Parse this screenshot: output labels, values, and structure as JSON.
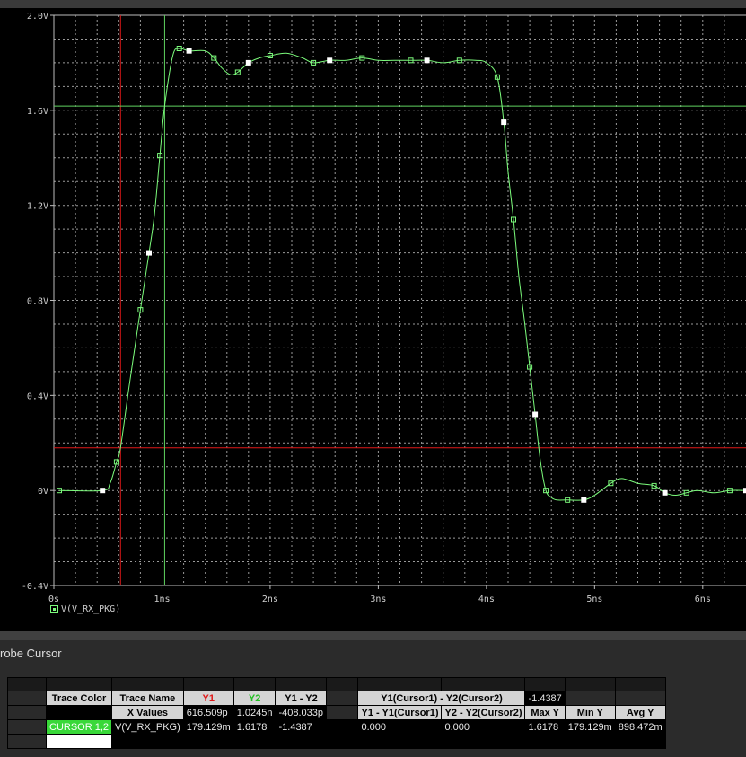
{
  "chart_data": {
    "type": "line",
    "x": [
      0.05,
      0.45,
      0.52,
      0.58,
      0.616,
      0.7,
      0.8,
      0.88,
      0.93,
      0.98,
      1.0245,
      1.1,
      1.16,
      1.25,
      1.4,
      1.48,
      1.55,
      1.63,
      1.7,
      1.8,
      1.9,
      2.0,
      2.15,
      2.3,
      2.4,
      2.55,
      2.7,
      2.85,
      3.0,
      3.15,
      3.3,
      3.45,
      3.6,
      3.75,
      3.9,
      4.0,
      4.1,
      4.16,
      4.2,
      4.25,
      4.3,
      4.35,
      4.4,
      4.45,
      4.5,
      4.55,
      4.6,
      4.65,
      4.75,
      4.9,
      5.0,
      5.15,
      5.25,
      5.4,
      5.55,
      5.65,
      5.75,
      5.85,
      5.95,
      6.1,
      6.25,
      6.4
    ],
    "values": [
      0.0,
      0.0,
      0.03,
      0.12,
      0.179,
      0.45,
      0.76,
      1.0,
      1.16,
      1.41,
      1.6178,
      1.83,
      1.86,
      1.85,
      1.85,
      1.82,
      1.78,
      1.75,
      1.76,
      1.8,
      1.82,
      1.83,
      1.84,
      1.82,
      1.8,
      1.81,
      1.81,
      1.82,
      1.81,
      1.81,
      1.81,
      1.81,
      1.8,
      1.81,
      1.81,
      1.8,
      1.74,
      1.55,
      1.34,
      1.14,
      0.9,
      0.72,
      0.52,
      0.32,
      0.12,
      0.0,
      -0.03,
      -0.04,
      -0.04,
      -0.04,
      -0.02,
      0.03,
      0.05,
      0.03,
      0.02,
      -0.01,
      -0.02,
      -0.01,
      0.0,
      -0.01,
      0.0,
      0.0
    ],
    "xlim": [
      0,
      6.4
    ],
    "ylim": [
      -0.4,
      2.0
    ],
    "x_ticks": [
      0,
      1,
      2,
      3,
      4,
      5,
      6
    ],
    "x_tick_labels": [
      "0s",
      "1ns",
      "2ns",
      "3ns",
      "4ns",
      "5ns",
      "6ns"
    ],
    "y_ticks": [
      -0.4,
      0,
      0.4,
      0.8,
      1.2,
      1.6,
      2.0
    ],
    "y_tick_labels": [
      "-0.4V",
      "0V",
      "0.4V",
      "0.8V",
      "1.2V",
      "1.6V",
      "2.0V"
    ],
    "series_name": "V(V_RX_PKG)",
    "grid": true,
    "cursor1": {
      "x": 0.616509,
      "y": 0.179129,
      "color": "#e01818"
    },
    "cursor2": {
      "x": 1.0245,
      "y": 1.6178,
      "color": "#5fd35f"
    },
    "trace_color": "#7CFC7C"
  },
  "panel": {
    "title": "robe Cursor"
  },
  "table": {
    "h_trace_color": "Trace Color",
    "h_trace_name": "Trace Name",
    "h_y1": "Y1",
    "h_y2": "Y2",
    "h_y1_y2": "Y1 - Y2",
    "h_cursor_diff": "Y1(Cursor1) - Y2(Cursor2)",
    "cursor_diff_value": "-1.4387",
    "h_x_values": "X Values",
    "x1": "616.509p",
    "x2": "1.0245n",
    "x_diff": "-408.033p",
    "h_y1_y1": "Y1 - Y1(Cursor1)",
    "h_y2_y2": "Y2 - Y2(Cursor2)",
    "h_max_y": "Max Y",
    "h_min_y": "Min Y",
    "h_avg_y": "Avg Y",
    "cursor_label": "CURSOR 1,2",
    "trace_name": "V(V_RX_PKG)",
    "y1_val": "179.129m",
    "y2_val": "1.6178",
    "y_diff": "-1.4387",
    "y1_y1_val": "0.000",
    "y2_y2_val": "0.000",
    "max_y": "1.6178",
    "min_y": "179.129m",
    "avg_y": "898.472m"
  }
}
